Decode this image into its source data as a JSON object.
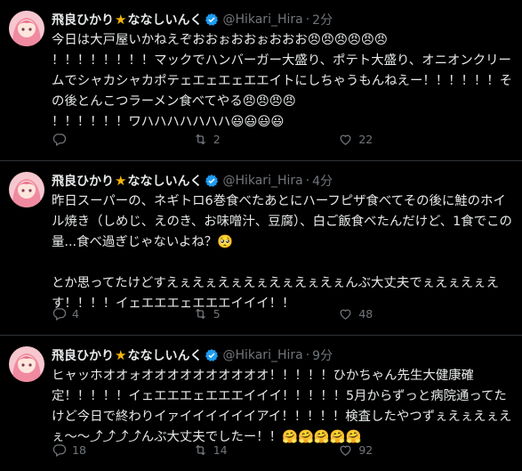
{
  "tweets": [
    {
      "name": "飛良ひかり",
      "name_suffix": "ななしいんく",
      "handle": "@Hikari_Hira",
      "time": "2分",
      "text": "今日は大戸屋いかねえぞおおぉおおぉおおお😠😠😠😠😠😠\n！！！！！！！！マックでハンバーガー大盛り、ポテト大盛り、オニオンクリームでシャカシャカポテェエェエェエエイトにしちゃうもんねえー！！！！！！その後とんこつラーメン食べてやる😠😠😠😠\n！！！！！！ワハハハハハハハ😃😃😃😃",
      "replies": "",
      "retweets": "2",
      "likes": "22"
    },
    {
      "name": "飛良ひかり",
      "name_suffix": "ななしいんく",
      "handle": "@Hikari_Hira",
      "time": "4分",
      "text": "昨日スーパーの、ネギトロ6巻食べたあとにハーフピザ食べてその後に鮭のホイル焼き（しめじ、えのき、お味噌汁、豆腐）、白ご飯食べたんだけど、1食でこの量...食べ過ぎじゃないよね？🥺\n\nとか思ってたけどすえぇえぇえぇえぇえぇえぇえぇんぶ大丈夫でぇえぇえぇえす！！！！イェエエエェエエエイイイ！！",
      "replies": "4",
      "retweets": "5",
      "likes": "48"
    },
    {
      "name": "飛良ひかり",
      "name_suffix": "ななしいんく",
      "handle": "@Hikari_Hira",
      "time": "9分",
      "text": "ヒャッホオオォオオオオオオオオオオ！！！！！ひかちゃん先生大健康確定！！！！！イェエエエェエエエイイイ！！！！！5月からずっと病院通ってたけど今日で終わりイァイイイイイイアイ！！！！！検査したやつずぇえぇえぇえぇ〜〜⤴⤴⤴⤴んぶ大丈夫でしたー！！🤗🤗🤗🤗🤗",
      "replies": "18",
      "retweets": "14",
      "likes": "92"
    }
  ],
  "colors": {
    "background": "#000000",
    "text": "#e7e9ea",
    "muted": "#71767b",
    "divider": "#2f3336",
    "verified": "#1d9bf0",
    "star": "#f5b50a"
  }
}
